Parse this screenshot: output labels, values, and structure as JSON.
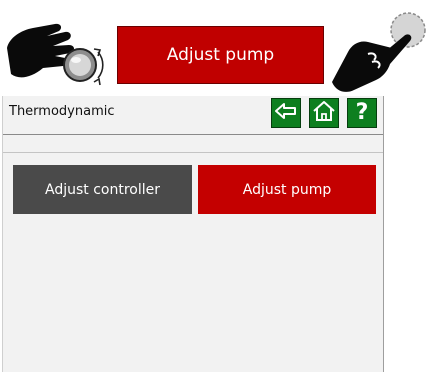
{
  "instruction": {
    "button_label": "Adjust pump",
    "left_icon": "hand-turning-knob-icon",
    "right_icon": "hand-pointing-tap-icon"
  },
  "panel": {
    "title": "Thermodynamic",
    "nav": {
      "back_icon": "back-arrow-icon",
      "home_icon": "home-icon",
      "help_label": "?"
    },
    "tabs": [
      {
        "label": "Adjust controller",
        "selected": false
      },
      {
        "label": "Adjust pump",
        "selected": true
      }
    ]
  },
  "colors": {
    "pump_red": "#c00000",
    "controller_gray": "#4a4a4a",
    "nav_green": "#0d7f1f",
    "panel_bg": "#f2f2f2"
  }
}
